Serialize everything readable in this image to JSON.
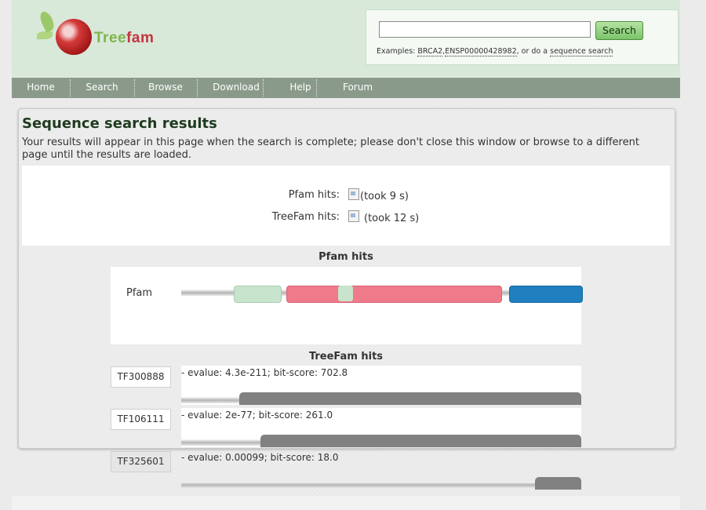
{
  "brand": {
    "name_part1": "Tree",
    "name_part2": "fam"
  },
  "search": {
    "value": "",
    "button_label": "Search",
    "examples_prefix": "Examples:",
    "example_1": "BRCA2",
    "example_sep": ",",
    "example_2": "ENSP00000428982",
    "examples_middle": ", or do a",
    "sequence_search_link": "sequence search"
  },
  "nav": {
    "items": [
      "Home",
      "Search",
      "Browse",
      "Download",
      "Help",
      "Forum"
    ]
  },
  "page": {
    "title": "Sequence search results",
    "intro": "Your results will appear in this page when the search is complete; please don't close this window or browse to a different page until the results are loaded."
  },
  "status": {
    "pfam_label": "Pfam hits:",
    "pfam_time": "(took 9 s)",
    "treefam_label": "TreeFam hits:",
    "treefam_time": "(took 12 s)"
  },
  "pfam_section": {
    "title": "Pfam hits",
    "row_label": "Pfam",
    "domain_colors": [
      "#c8e4cc",
      "#ee7a8a",
      "#1f7fbf"
    ]
  },
  "treefam_section": {
    "title": "TreeFam hits",
    "hits": [
      {
        "id": "TF300888",
        "evalue": "4.3e-211",
        "bitscore": "702.8",
        "text": "- evalue: 4.3e-211; bit-score: 702.8"
      },
      {
        "id": "TF106111",
        "evalue": "2e-77",
        "bitscore": "261.0",
        "text": "- evalue: 2e-77; bit-score: 261.0"
      },
      {
        "id": "TF325601",
        "evalue": "0.00099",
        "bitscore": "18.0",
        "text": "- evalue: 0.00099; bit-score: 18.0"
      }
    ]
  },
  "colors": {
    "header_bg": "#d8e8d9",
    "nav_bg": "#8a9a8a",
    "title": "#1f3a1f",
    "bar": "#818181"
  }
}
